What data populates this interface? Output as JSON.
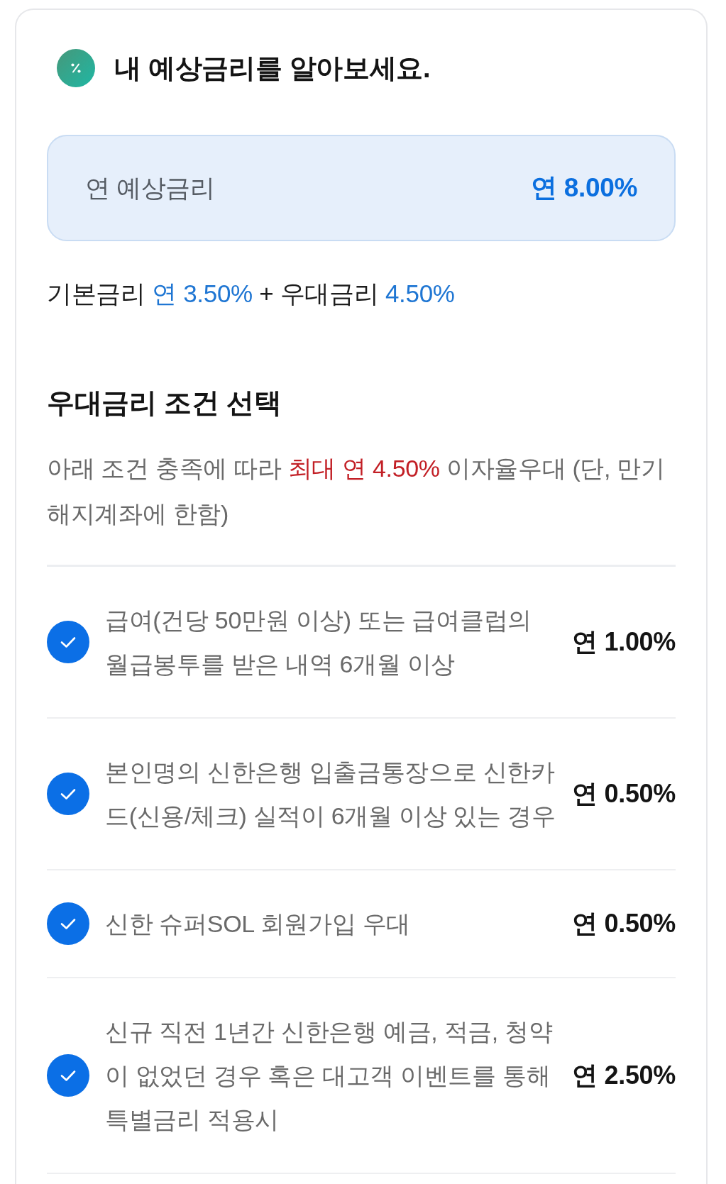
{
  "header": {
    "title": "내 예상금리를 알아보세요."
  },
  "expected_rate": {
    "label": "연 예상금리",
    "value": "연 8.00%"
  },
  "rate_summary": [
    {
      "kind": "plain",
      "text": "기본금리"
    },
    {
      "kind": "rate",
      "text": "연 3.50%"
    },
    {
      "kind": "plain",
      "text": "+ 우대금리"
    },
    {
      "kind": "rate",
      "text": "4.50%"
    }
  ],
  "preferential": {
    "title": "우대금리 조건 선택",
    "description": [
      {
        "kind": "plain",
        "text": "아래 조건 충족에 따라"
      },
      {
        "kind": "highlight",
        "text": "최대 연 4.50%"
      },
      {
        "kind": "plain",
        "text": "이자율우대 (단, 만기해지계좌에 한함)"
      }
    ],
    "conditions": [
      {
        "text": "급여(건당 50만원 이상) 또는 급여클럽의 월급봉투를 받은 내역 6개월 이상",
        "rate": "연 1.00%",
        "checked": true
      },
      {
        "text": "본인명의 신한은행 입출금통장으로 신한카드(신용/체크) 실적이 6개월 이상 있는 경우",
        "rate": "연 0.50%",
        "checked": true
      },
      {
        "text": "신한 슈퍼SOL 회원가입 우대",
        "rate": "연 0.50%",
        "checked": true
      },
      {
        "text": "신규 직전 1년간 신한은행 예금, 적금, 청약이 없었던 경우 혹은 대고객 이벤트를 통해 특별금리 적용시",
        "rate": "연 2.50%",
        "checked": true
      }
    ]
  }
}
